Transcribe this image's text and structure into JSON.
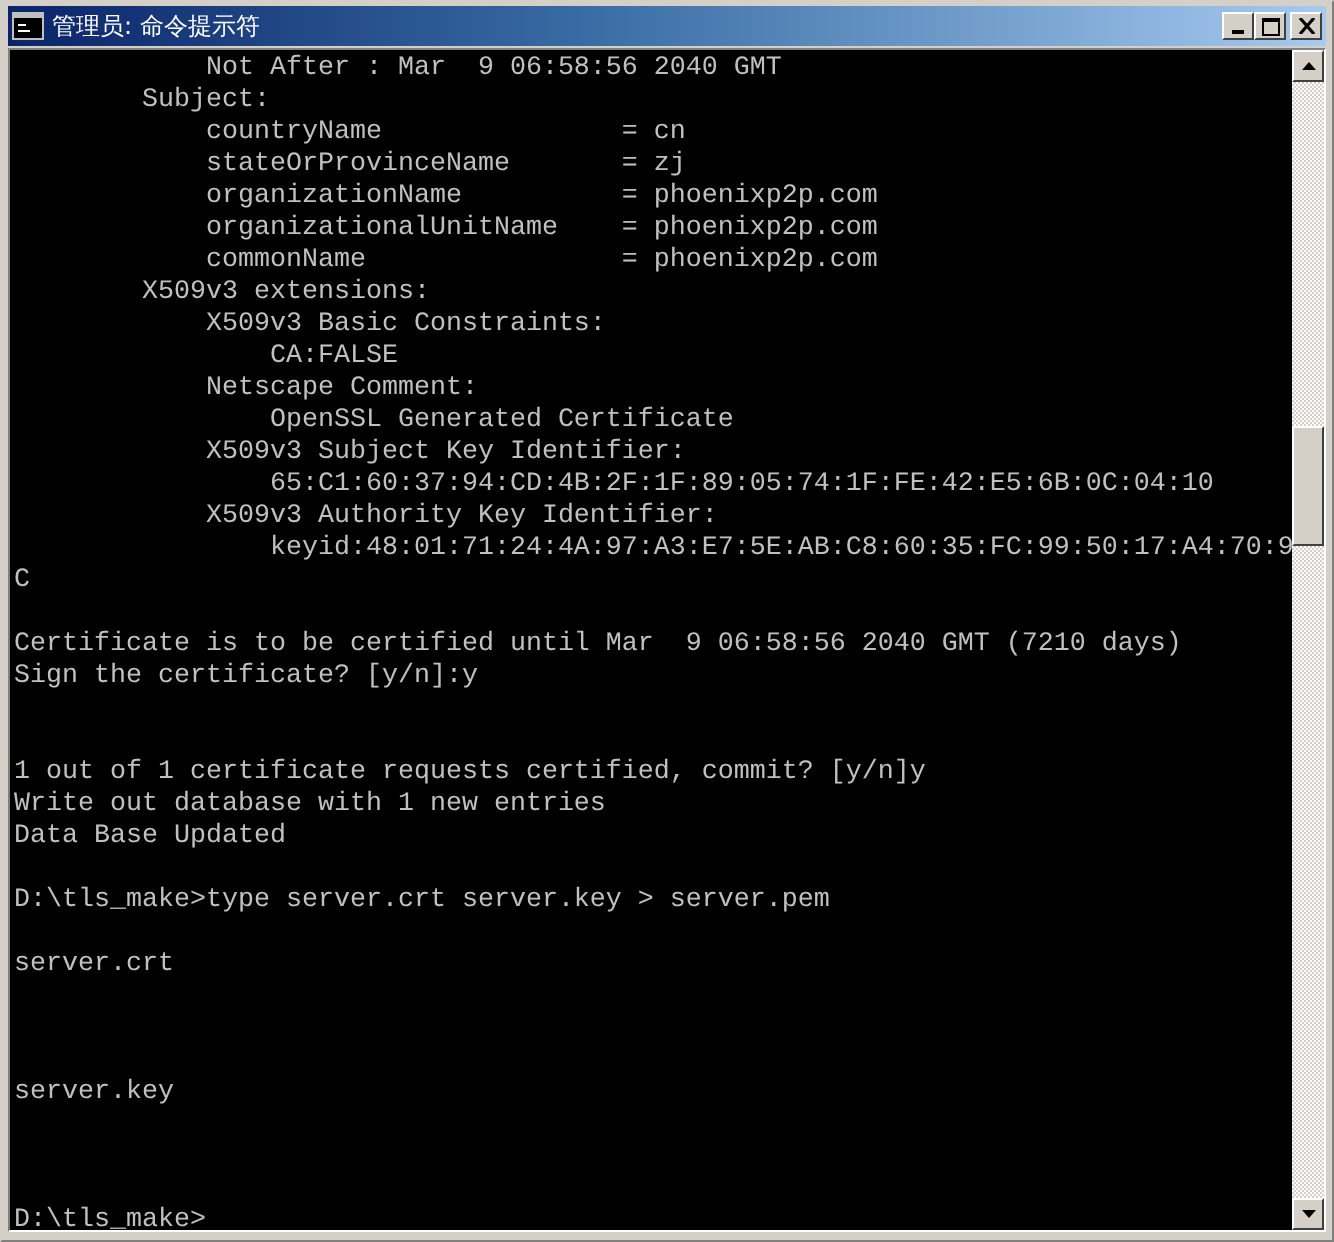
{
  "window": {
    "title": "管理员: 命令提示符"
  },
  "console_lines": [
    {
      "kind": "text",
      "text": "            Not After : Mar  9 06:58:56 2040 GMT"
    },
    {
      "kind": "text",
      "text": "        Subject:"
    },
    {
      "kind": "text",
      "text": "            countryName               = cn"
    },
    {
      "kind": "text",
      "text": "            stateOrProvinceName       = zj"
    },
    {
      "kind": "text",
      "text": "            organizationName          = phoenixp2p.com"
    },
    {
      "kind": "text",
      "text": "            organizationalUnitName    = phoenixp2p.com"
    },
    {
      "kind": "text",
      "text": "            commonName                = phoenixp2p.com"
    },
    {
      "kind": "text",
      "text": "        X509v3 extensions:"
    },
    {
      "kind": "text",
      "text": "            X509v3 Basic Constraints:"
    },
    {
      "kind": "text",
      "text": "                CA:FALSE"
    },
    {
      "kind": "text",
      "text": "            Netscape Comment:"
    },
    {
      "kind": "text",
      "text": "                OpenSSL Generated Certificate"
    },
    {
      "kind": "text",
      "text": "            X509v3 Subject Key Identifier:"
    },
    {
      "kind": "text",
      "text": "                65:C1:60:37:94:CD:4B:2F:1F:89:05:74:1F:FE:42:E5:6B:0C:04:10"
    },
    {
      "kind": "text",
      "text": "            X509v3 Authority Key Identifier:"
    },
    {
      "kind": "text",
      "text": "                keyid:48:01:71:24:4A:97:A3:E7:5E:AB:C8:60:35:FC:99:50:17:A4:70:9"
    },
    {
      "kind": "text",
      "text": "C"
    },
    {
      "kind": "blank"
    },
    {
      "kind": "text",
      "text": "Certificate is to be certified until Mar  9 06:58:56 2040 GMT (7210 days)"
    },
    {
      "kind": "text",
      "text": "Sign the certificate? [y/n]:y"
    },
    {
      "kind": "blank"
    },
    {
      "kind": "blank"
    },
    {
      "kind": "text",
      "text": "1 out of 1 certificate requests certified, commit? [y/n]y"
    },
    {
      "kind": "text",
      "text": "Write out database with 1 new entries"
    },
    {
      "kind": "text",
      "text": "Data Base Updated"
    },
    {
      "kind": "blank"
    },
    {
      "kind": "text",
      "text": "D:\\tls_make>type server.crt server.key > server.pem"
    },
    {
      "kind": "blank"
    },
    {
      "kind": "text",
      "text": "server.crt"
    },
    {
      "kind": "blank"
    },
    {
      "kind": "blank"
    },
    {
      "kind": "blank"
    },
    {
      "kind": "text",
      "text": "server.key"
    },
    {
      "kind": "blank"
    },
    {
      "kind": "blank"
    },
    {
      "kind": "blank"
    },
    {
      "kind": "text",
      "text": "D:\\tls_make>"
    }
  ]
}
